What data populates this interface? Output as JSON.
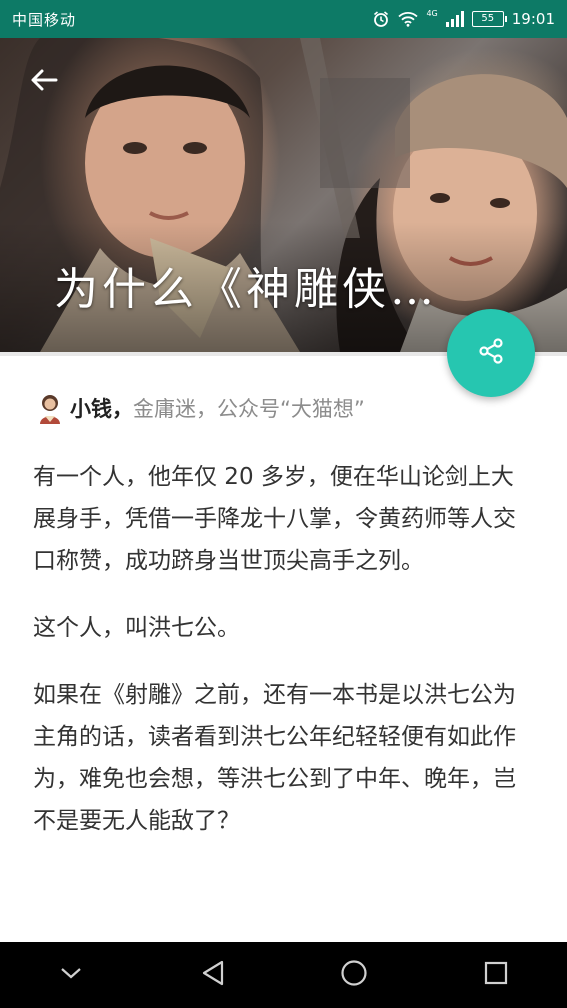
{
  "status_bar": {
    "carrier": "中国移动",
    "network": "4G",
    "battery": "55",
    "time": "19:01"
  },
  "hero": {
    "title": "为什么《神雕侠…"
  },
  "author": {
    "name": "小钱，",
    "bio": "金庸迷，公众号“大猫想”"
  },
  "article": {
    "paragraphs": [
      "有一个人，他年仅 20 多岁，便在华山论剑上大展身手，凭借一手降龙十八掌，令黄药师等人交口称赞，成功跻身当世顶尖高手之列。",
      "这个人，叫洪七公。",
      "如果在《射雕》之前，还有一本书是以洪七公为主角的话，读者看到洪七公年纪轻轻便有如此作为，难免也会想，等洪七公到了中年、晚年，岂不是要无人能敌了？"
    ]
  },
  "colors": {
    "status_bar": "#0d7a66",
    "share_button": "#26c6b0"
  },
  "icons": {
    "back": "arrow-left-icon",
    "share": "share-icon",
    "nav_back": "triangle-back-icon",
    "nav_home": "circle-home-icon",
    "nav_recents": "square-recents-icon",
    "nav_collapse": "chevron-down-icon"
  }
}
